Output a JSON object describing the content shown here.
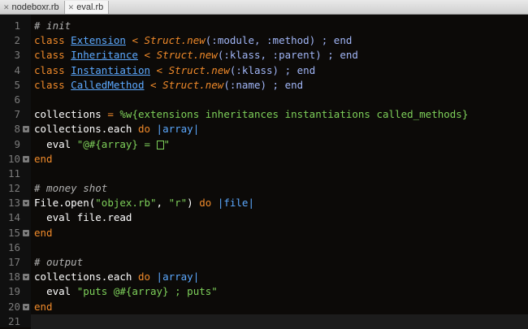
{
  "tabs": [
    {
      "label": "nodeboxr.rb",
      "active": false
    },
    {
      "label": "eval.rb",
      "active": true
    }
  ],
  "line_numbers": [
    "1",
    "2",
    "3",
    "4",
    "5",
    "6",
    "7",
    "8",
    "9",
    "10",
    "11",
    "12",
    "13",
    "14",
    "15",
    "16",
    "17",
    "18",
    "19",
    "20",
    "21"
  ],
  "code": {
    "l1": "# init",
    "l2": {
      "kw": "class",
      "name": "Extension",
      "lt": "<",
      "st": "Struct.new",
      "rest": "(:module, :method) ; end"
    },
    "l3": {
      "kw": "class",
      "name": "Inheritance",
      "lt": "<",
      "st": "Struct.new",
      "rest": "(:klass, :parent) ; end"
    },
    "l4": {
      "kw": "class",
      "name": "Instantiation",
      "lt": "<",
      "st": "Struct.new",
      "rest": "(:klass) ; end"
    },
    "l5": {
      "kw": "class",
      "name": "CalledMethod",
      "lt": "<",
      "st": "Struct.new",
      "rest": "(:name) ; end"
    },
    "l7": {
      "var": "collections",
      "eq": "=",
      "lit": "%w{extensions inheritances instantiations called_methods}"
    },
    "l8": {
      "recv": "collections.each",
      "kw": "do",
      "arg": "|array|"
    },
    "l9": {
      "call": "eval",
      "str1": "\"@#{array} = ",
      "str2": "\""
    },
    "l10": "end",
    "l12": "# money shot",
    "l13": {
      "recv": "File.open(",
      "s1": "\"objex.rb\"",
      "sep": ", ",
      "s2": "\"r\"",
      "close": ")",
      "kw": "do",
      "arg": "|file|"
    },
    "l14": "eval file.read",
    "l15": "end",
    "l17": "# output",
    "l18": {
      "recv": "collections.each",
      "kw": "do",
      "arg": "|array|"
    },
    "l19": {
      "call": "eval",
      "str": "\"puts @#{array} ; puts\""
    },
    "l20": "end"
  },
  "colors": {
    "background": "#0c0a08",
    "keyword": "#f08a2a",
    "class_name": "#5ca9ff",
    "string": "#7ed05a",
    "comment": "#b0b0b0"
  }
}
